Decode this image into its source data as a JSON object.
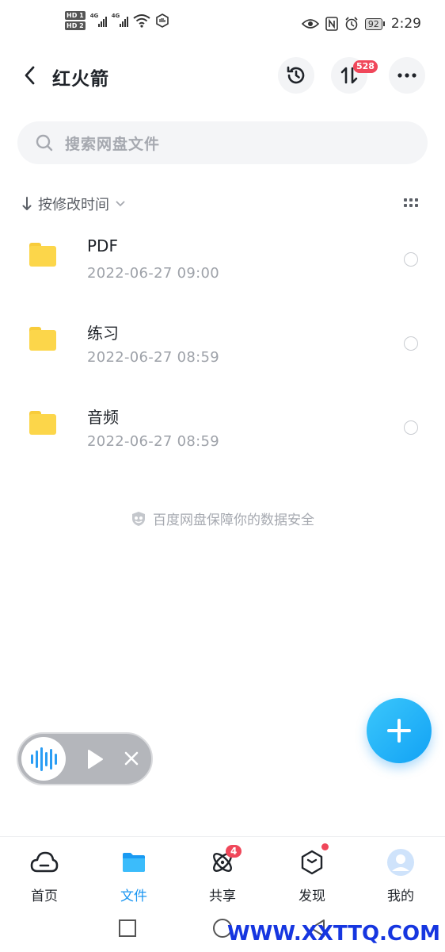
{
  "status_bar": {
    "hd1": "HD 1",
    "hd2": "HD 2",
    "network1": "4G",
    "network2": "4G",
    "battery": "92",
    "time": "2:29"
  },
  "header": {
    "title": "红火箭",
    "transfer_badge": "528"
  },
  "search": {
    "placeholder": "搜索网盘文件"
  },
  "sort": {
    "label": "按修改时间"
  },
  "files": [
    {
      "name": "PDF",
      "modified": "2022-06-27  09:00"
    },
    {
      "name": "练习",
      "modified": "2022-06-27  08:59"
    },
    {
      "name": "音频",
      "modified": "2022-06-27  08:59"
    }
  ],
  "safety_notice": "百度网盘保障你的数据安全",
  "bottom_nav": {
    "items": [
      {
        "label": "首页",
        "icon": "cloud-icon"
      },
      {
        "label": "文件",
        "icon": "folder-icon",
        "active": true
      },
      {
        "label": "共享",
        "icon": "share-atom-icon",
        "badge": "4"
      },
      {
        "label": "发现",
        "icon": "discover-cube-icon",
        "dot": true
      },
      {
        "label": "我的",
        "icon": "avatar-icon"
      }
    ]
  },
  "watermark": "WWW.XXTTQ.COM",
  "colors": {
    "accent": "#1a96f2",
    "badge": "#f0475a",
    "folder": "#fcd64a"
  }
}
